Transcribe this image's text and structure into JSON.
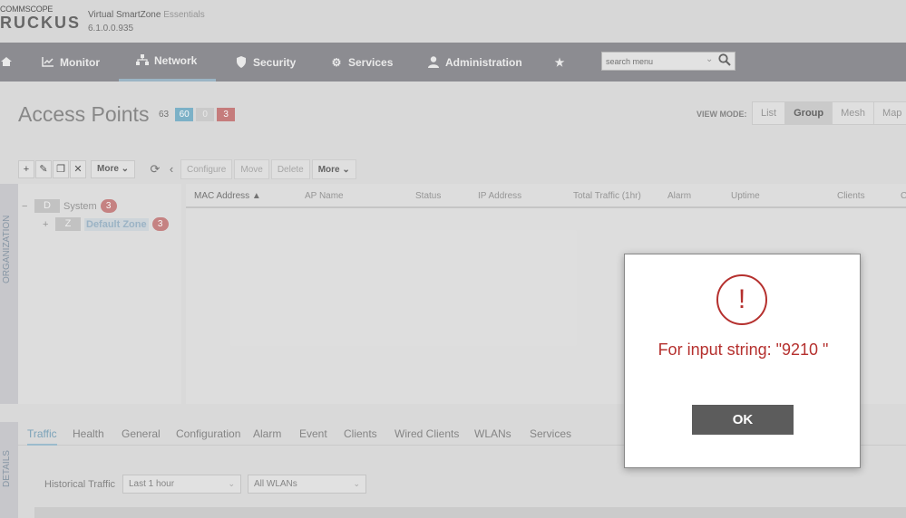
{
  "brand": {
    "logo_top": "COMMSCOPE",
    "logo_main": "RUCKUS",
    "product": "Virtual SmartZone",
    "edition": "Essentials",
    "version": "6.1.0.0.935"
  },
  "nav": {
    "items": [
      {
        "label": "Monitor",
        "icon": "chart-icon"
      },
      {
        "label": "Network",
        "icon": "network-icon",
        "active": true
      },
      {
        "label": "Security",
        "icon": "shield-icon"
      },
      {
        "label": "Services",
        "icon": "gears-icon"
      },
      {
        "label": "Administration",
        "icon": "user-icon"
      }
    ],
    "search_placeholder": "search menu"
  },
  "page": {
    "title": "Access Points",
    "count_total": "63",
    "count_online": "60",
    "count_flagged": "0",
    "count_offline": "3"
  },
  "view_mode": {
    "label": "VIEW MODE:",
    "options": [
      "List",
      "Group",
      "Mesh",
      "Map"
    ],
    "selected": "Group"
  },
  "toolbar": {
    "more_label": "More",
    "configure": "Configure",
    "move": "Move",
    "delete": "Delete",
    "more2_label": "More"
  },
  "org": {
    "strip_label": "ORGANIZATION",
    "tree": [
      {
        "toggle": "−",
        "box": "D",
        "label": "System",
        "badge": "3"
      },
      {
        "toggle": "+",
        "box": "Z",
        "label": "Default Zone",
        "badge": "3"
      }
    ]
  },
  "table": {
    "columns": [
      "MAC Address",
      "AP Name",
      "Status",
      "IP Address",
      "Total Traffic (1hr)",
      "Alarm",
      "Uptime",
      "Clients",
      "C"
    ]
  },
  "details": {
    "strip_label": "DETAILS",
    "tabs": [
      "Traffic",
      "Health",
      "General",
      "Configuration",
      "Alarm",
      "Event",
      "Clients",
      "Wired Clients",
      "WLANs",
      "Services"
    ],
    "active_tab": "Traffic",
    "historical_label": "Historical Traffic",
    "time_range": "Last 1 hour",
    "wlan_filter": "All WLANs"
  },
  "dialog": {
    "icon": "!",
    "message": "For input string: \"9210 \"",
    "ok_label": "OK",
    "accent": "#b5302e"
  }
}
